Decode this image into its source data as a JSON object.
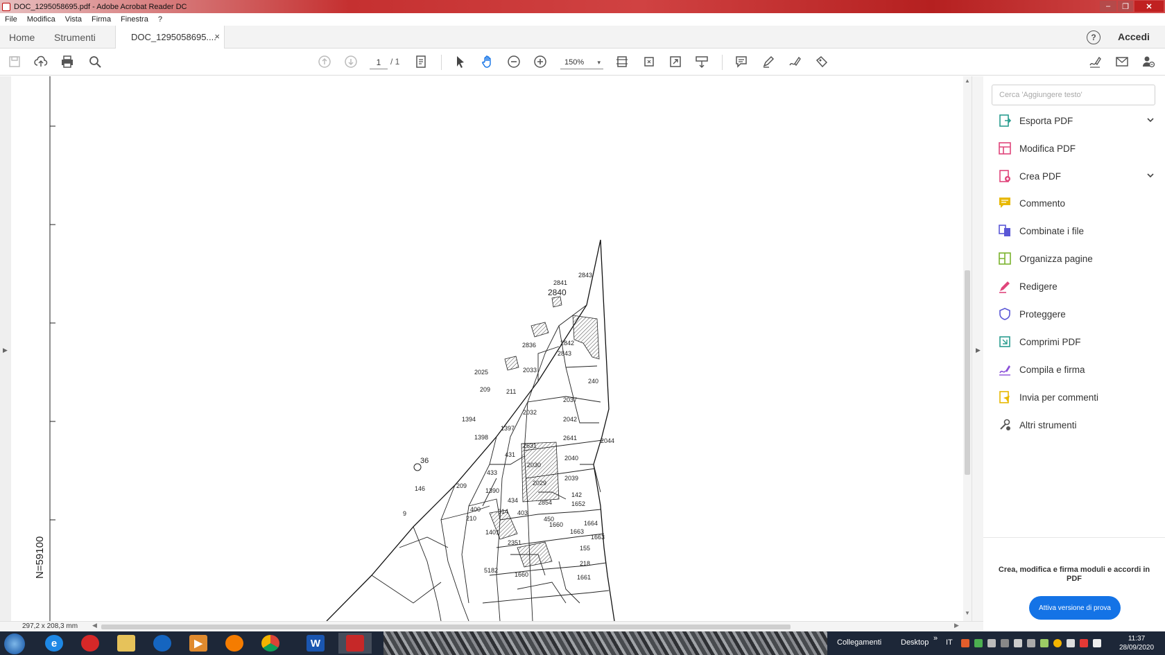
{
  "window": {
    "title": "DOC_1295058695.pdf - Adobe Acrobat Reader DC",
    "minimize_label": "–",
    "maximize_label": "❐",
    "close_label": "✕"
  },
  "menu": [
    "File",
    "Modifica",
    "Vista",
    "Firma",
    "Finestra",
    "?"
  ],
  "tabs": {
    "home": "Home",
    "tools": "Strumenti",
    "document": "DOC_1295058695....",
    "document_close": "×",
    "help": "?",
    "signin": "Accedi"
  },
  "toolbar": {
    "page_current": "1",
    "page_total": "/ 1",
    "zoom": "150%",
    "zoom_caret": "▾"
  },
  "document": {
    "north_coordinate": "N=59100",
    "parcel_labels": [
      "2843",
      "2841",
      "2840",
      "2836",
      "2842",
      "2843",
      "2033",
      "2025",
      "240",
      "209",
      "211",
      "2037",
      "1394",
      "2032",
      "2042",
      "1398",
      "1397",
      "2631",
      "2641",
      "2044",
      "36",
      "431",
      "2030",
      "2040",
      "433",
      "2029",
      "2039",
      "146",
      "209",
      "1390",
      "142",
      "9",
      "400",
      "434",
      "1652",
      "210",
      "314",
      "403",
      "2854",
      "450",
      "1660",
      "1664",
      "1401",
      "1663",
      "1663",
      "155",
      "2351",
      "218",
      "1661",
      "1660",
      "5182"
    ],
    "page_size": "297,2 x 208,3 mm"
  },
  "right_pane": {
    "search_placeholder": "Cerca 'Aggiungere testo'",
    "tools": [
      {
        "label": "Esporta PDF",
        "icon": "export-pdf-icon",
        "color": "#2a9d8f",
        "expandable": true
      },
      {
        "label": "Modifica PDF",
        "icon": "edit-pdf-icon",
        "color": "#e0457b",
        "expandable": false
      },
      {
        "label": "Crea PDF",
        "icon": "create-pdf-icon",
        "color": "#e0457b",
        "expandable": true
      },
      {
        "label": "Commento",
        "icon": "comment-icon",
        "color": "#e8b800",
        "expandable": false
      },
      {
        "label": "Combinate i file",
        "icon": "combine-files-icon",
        "color": "#5a57d6",
        "expandable": false
      },
      {
        "label": "Organizza pagine",
        "icon": "organize-pages-icon",
        "color": "#7bb32e",
        "expandable": false
      },
      {
        "label": "Redigere",
        "icon": "redact-icon",
        "color": "#e0457b",
        "expandable": false
      },
      {
        "label": "Proteggere",
        "icon": "protect-icon",
        "color": "#5a57d6",
        "expandable": false
      },
      {
        "label": "Comprimi PDF",
        "icon": "compress-pdf-icon",
        "color": "#2a9d8f",
        "expandable": false
      },
      {
        "label": "Compila e firma",
        "icon": "fill-sign-icon",
        "color": "#8a4fd8",
        "expandable": false
      },
      {
        "label": "Invia per commenti",
        "icon": "send-for-comments-icon",
        "color": "#e8b800",
        "expandable": false
      },
      {
        "label": "Altri strumenti",
        "icon": "more-tools-icon",
        "color": "#555555",
        "expandable": false
      }
    ],
    "promo_text": "Crea, modifica e firma moduli e accordi in PDF",
    "promo_button": "Attiva versione di prova"
  },
  "taskbar": {
    "links_label": "Collegamenti",
    "desktop_label": "Desktop",
    "desktop_chevron": "»",
    "language": "IT",
    "time": "11:37",
    "date": "28/09/2020",
    "word_letter": "W"
  },
  "colors": {
    "accent_blue": "#1473e6",
    "title_red": "#c53030"
  }
}
